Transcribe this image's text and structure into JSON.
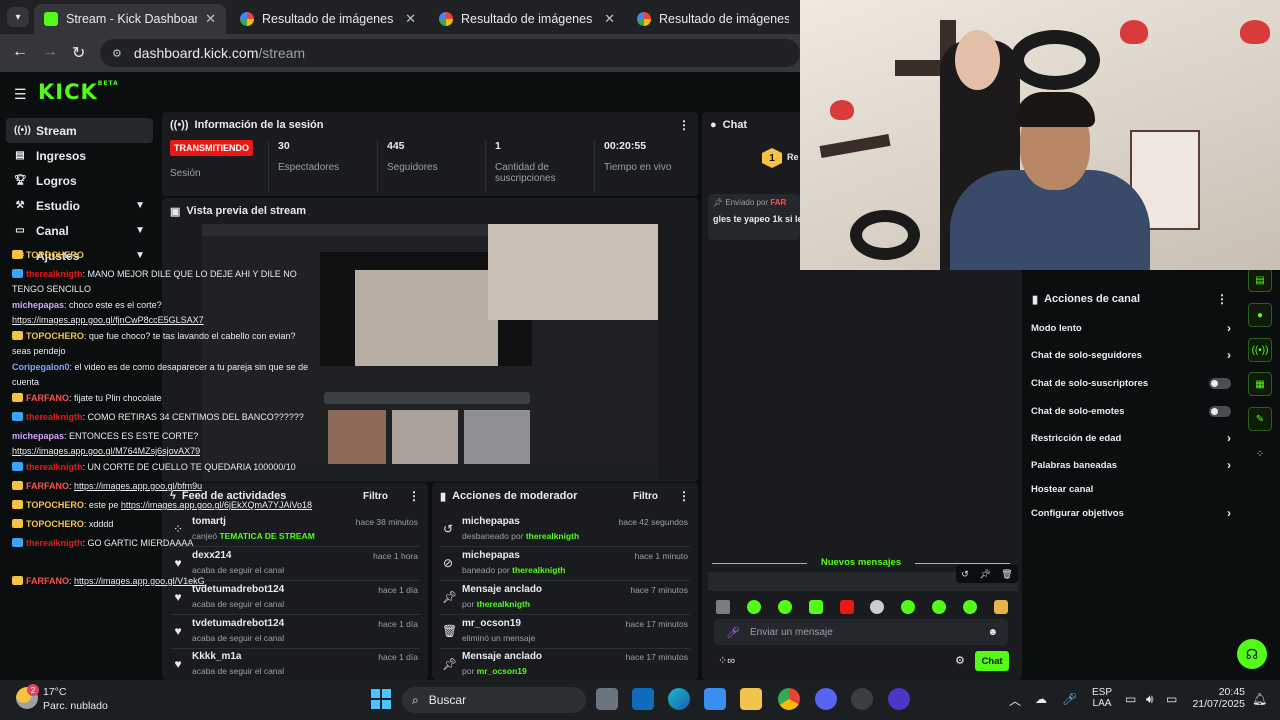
{
  "browser": {
    "tabs": [
      {
        "title": "Stream - Kick Dashboard",
        "active": true
      },
      {
        "title": "Resultado de imágenes de Goo"
      },
      {
        "title": "Resultado de imágenes de Goo"
      },
      {
        "title": "Resultado de imágenes de Goo"
      }
    ],
    "url_host": "dashboard.kick.com",
    "url_path": "/stream"
  },
  "app": {
    "logo": "KICK",
    "logo_badge": "BETA",
    "brand_color": "#53fc18"
  },
  "sidebar": {
    "items": [
      {
        "label": "Stream",
        "active": true
      },
      {
        "label": "Ingresos"
      },
      {
        "label": "Logros"
      },
      {
        "label": "Estudio",
        "expandable": true
      },
      {
        "label": "Canal",
        "expandable": true
      },
      {
        "label": "Ajustes",
        "expandable": true
      }
    ]
  },
  "session": {
    "title": "Información de la sesión",
    "status": "TRANSMITIENDO",
    "status_label": "Sesión",
    "stats": [
      {
        "value": "30",
        "label": "Espectadores"
      },
      {
        "value": "445",
        "label": "Seguidores"
      },
      {
        "value": "1",
        "label": "Cantidad de suscripciones"
      },
      {
        "value": "00:20:55",
        "label": "Tiempo en vivo"
      }
    ]
  },
  "preview": {
    "title": "Vista previa del stream"
  },
  "activity_feed": {
    "title": "Feed de actividades",
    "filter": "Filtro",
    "items": [
      {
        "name": "tomartj",
        "detail_prefix": "canjeó",
        "detail_highlight": "TEMATICA DE STREAM",
        "time": "hace 38 minutos"
      },
      {
        "name": "dexx214",
        "detail_prefix": "acaba de seguir el canal",
        "detail_highlight": "",
        "time": "hace 1 hora"
      },
      {
        "name": "tvdetumadrebot124",
        "detail_prefix": "acaba de seguir el canal",
        "detail_highlight": "",
        "time": "hace 1 día"
      },
      {
        "name": "tvdetumadrebot124",
        "detail_prefix": "acaba de seguir el canal",
        "detail_highlight": "",
        "time": "hace 1 día"
      },
      {
        "name": "Kkkk_m1a",
        "detail_prefix": "acaba de seguir el canal",
        "detail_highlight": "",
        "time": "hace 1 día"
      }
    ]
  },
  "mod_actions": {
    "title": "Acciones de moderador",
    "filter": "Filtro",
    "items": [
      {
        "name": "michepapas",
        "detail_prefix": "desbaneado por",
        "detail_highlight": "therealknigth",
        "time": "hace 42 segundos"
      },
      {
        "name": "michepapas",
        "detail_prefix": "baneado por",
        "detail_highlight": "therealknigth",
        "time": "hace 1 minuto"
      },
      {
        "name": "Mensaje anclado",
        "detail_prefix": "por",
        "detail_highlight": "therealknigth",
        "time": "hace 7 minutos"
      },
      {
        "name": "mr_ocson19",
        "detail_prefix": "eliminó un mensaje",
        "detail_highlight": "",
        "time": "hace 17 minutos"
      },
      {
        "name": "Mensaje anclado",
        "detail_prefix": "por",
        "detail_highlight": "mr_ocson19",
        "time": "hace 17 minutos"
      }
    ]
  },
  "chat": {
    "title": "Chat",
    "leaderboard_rank": "1",
    "leaderboard_text": "Re",
    "pinned_label": "Enviado por",
    "pinned_user": "FAR",
    "pinned_text": "gles te yapeo 1k si le",
    "messages": [
      {
        "user": "TOPOCHERO",
        "color": "#f5c242",
        "text": "",
        "link": ""
      },
      {
        "user": "therealknigth",
        "color": "#e91916",
        "text": "MANO MEJOR DILE QUE LO DEJE AHI Y DILE NO TENGO SENCILLO",
        "link": ""
      },
      {
        "user": "michepapas",
        "color": "#d4a5ff",
        "text": "choco este es el corte?",
        "link": "https://images.app.goo.gl/fjnCwP8ccE5GLSAX7"
      },
      {
        "user": "TOPOCHERO",
        "color": "#f5c242",
        "text": "que fue choco? te tas lavando el cabello con evian? seas pendejo",
        "link": ""
      },
      {
        "user": "Coripegalon0",
        "color": "#7aa7ff",
        "text": "el video es de como desaparecer a tu pareja sin que se de cuenta",
        "link": ""
      },
      {
        "user": "FARFANO",
        "color": "#ff4f4f",
        "text": "fijate tu Plin chocolate",
        "link": ""
      },
      {
        "user": "therealknigth",
        "color": "#e91916",
        "text": "COMO RETIRAS 34 CENTIMOS DEL BANCO??????",
        "link": ""
      },
      {
        "user": "michepapas",
        "color": "#d4a5ff",
        "text": "ENTONCES ES ESTE CORTE?",
        "link": "https://images.app.goo.gl/M764MZsj6sjovAX79"
      },
      {
        "user": "therealknigth",
        "color": "#e91916",
        "text": "UN CORTE DE CUELLO TE QUEDARIA 100000/10",
        "link": ""
      },
      {
        "user": "FARFANO",
        "color": "#ff4f4f",
        "text": "",
        "link": "https://images.app.goo.gl/bfm9u"
      },
      {
        "user": "TOPOCHERO",
        "color": "#f5c242",
        "text": "este pe",
        "link": "https://images.app.goo.gl/6jEkXQmA7YJAiVo18"
      },
      {
        "user": "TOPOCHERO",
        "color": "#f5c242",
        "text": "xdddd",
        "link": ""
      },
      {
        "user": "therealknigth",
        "color": "#e91916",
        "text": "GO GARTIC MIERDAAAA",
        "link": ""
      }
    ],
    "new_messages_label": "Nuevos mensajes",
    "last_message": {
      "user": "FARFANO",
      "link": "https://images.app.goo.gl/V1ekG"
    },
    "input_placeholder": "Enviar un mensaje",
    "send_label": "Chat"
  },
  "channel_actions": {
    "title": "Acciones de canal",
    "items": [
      {
        "label": "Modo lento",
        "control": "chevron"
      },
      {
        "label": "Chat de solo-seguidores",
        "control": "chevron"
      },
      {
        "label": "Chat de solo-suscriptores",
        "control": "toggle"
      },
      {
        "label": "Chat de solo-emotes",
        "control": "toggle"
      },
      {
        "label": "Restricción de edad",
        "control": "chevron"
      },
      {
        "label": "Palabras baneadas",
        "control": "chevron"
      },
      {
        "label": "Hostear canal",
        "control": "none"
      },
      {
        "label": "Configurar objetivos",
        "control": "chevron"
      }
    ]
  },
  "taskbar": {
    "weather_temp": "17°C",
    "weather_desc": "Parc. nublado",
    "weather_badge": "2",
    "search_placeholder": "Buscar",
    "lang_top": "ESP",
    "lang_bottom": "LAA",
    "time": "20:45",
    "date": "21/07/2025"
  }
}
